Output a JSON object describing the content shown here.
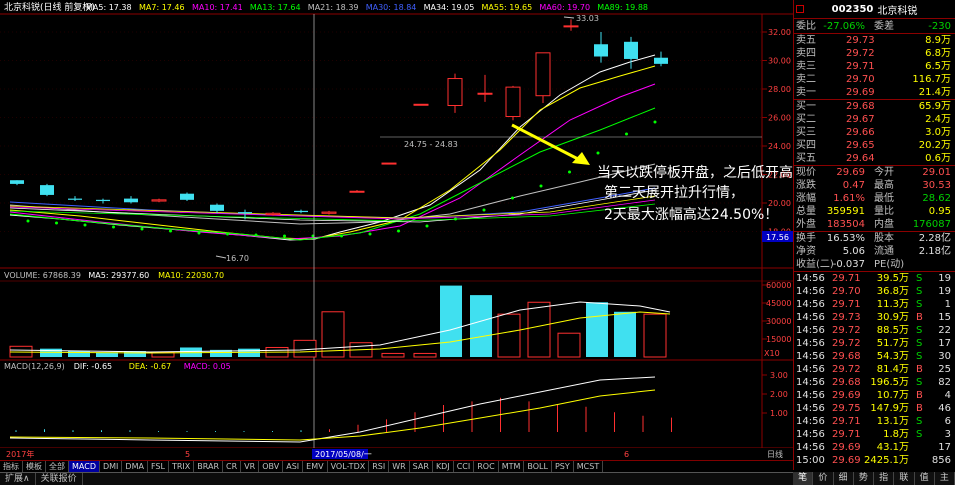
{
  "header": {
    "title": "北京科锐(日线 前复权)",
    "mas": [
      {
        "label": "MA5: 17.38",
        "color": "#ffffff"
      },
      {
        "label": "MA7: 17.46",
        "color": "#ffff00"
      },
      {
        "label": "MA10: 17.41",
        "color": "#ff00ff"
      },
      {
        "label": "MA13: 17.64",
        "color": "#00ff00"
      },
      {
        "label": "MA21: 18.39",
        "color": "#c0c0c0"
      },
      {
        "label": "MA30: 18.84",
        "color": "#4060ff"
      },
      {
        "label": "MA34: 19.05",
        "color": "#ffffff"
      },
      {
        "label": "MA55: 19.65",
        "color": "#ffff00"
      },
      {
        "label": "MA60: 19.70",
        "color": "#ff00ff"
      },
      {
        "label": "MA89: 19.88",
        "color": "#00ff00"
      }
    ]
  },
  "price_chart": {
    "y_ticks": [
      "32.00",
      "30.00",
      "28.00",
      "26.00",
      "24.00",
      "22.00",
      "20.00",
      "18.00"
    ],
    "current_price": "17.56",
    "high_label": "33.03",
    "low_label": "16.70",
    "range_label": "24.75 - 24.83",
    "annotation": [
      "当天以跌停板开盘，之后低开高走，",
      "第二天展开拉升行情，",
      "2天最大涨幅高达24.50%！"
    ]
  },
  "volume_chart": {
    "header": [
      {
        "label": "VOLUME: 67868.39",
        "color": "#c0c0c0"
      },
      {
        "label": "MA5: 29377.60",
        "color": "#ffffff"
      },
      {
        "label": "MA10: 22030.70",
        "color": "#ffff00"
      }
    ],
    "y_ticks": [
      "60000",
      "45000",
      "30000",
      "15000"
    ],
    "unit": "X10"
  },
  "macd_chart": {
    "header": [
      {
        "label": "MACD(12,26,9)",
        "color": "#c0c0c0"
      },
      {
        "label": "DIF: -0.65",
        "color": "#ffffff"
      },
      {
        "label": "DEA: -0.67",
        "color": "#ffff00"
      },
      {
        "label": "MACD: 0.05",
        "color": "#ff00ff"
      }
    ],
    "y_ticks": [
      "3.00",
      "2.00",
      "1.00"
    ]
  },
  "date_axis": {
    "year": "2017年",
    "m5": "5",
    "cursor": "2017/05/08/一",
    "m6": "6",
    "period": "日线"
  },
  "indicator_tabs": [
    "指标",
    "模板",
    "全部",
    "MACD",
    "DMI",
    "DMA",
    "FSL",
    "TRIX",
    "BRAR",
    "CR",
    "VR",
    "OBV",
    "ASI",
    "EMV",
    "VOL-TDX",
    "RSI",
    "WR",
    "SAR",
    "KDJ",
    "CCI",
    "ROC",
    "MTM",
    "BOLL",
    "PSY",
    "MCST"
  ],
  "bottom_bar": [
    "扩展∧",
    "关联报价"
  ],
  "right_tabs": [
    "笔",
    "价",
    "细",
    "势",
    "指",
    "联",
    "值",
    "主"
  ],
  "quote": {
    "code": "002350",
    "name": "北京科锐",
    "weibi": {
      "label": "委比",
      "value": "-27.06%",
      "label2": "委差",
      "value2": "-230"
    },
    "asks": [
      {
        "label": "卖五",
        "price": "29.73",
        "vol": "8.9万"
      },
      {
        "label": "卖四",
        "price": "29.72",
        "vol": "6.8万"
      },
      {
        "label": "卖三",
        "price": "29.71",
        "vol": "6.5万"
      },
      {
        "label": "卖二",
        "price": "29.70",
        "vol": "116.7万"
      },
      {
        "label": "卖一",
        "price": "29.69",
        "vol": "21.4万"
      }
    ],
    "bids": [
      {
        "label": "买一",
        "price": "29.68",
        "vol": "65.9万"
      },
      {
        "label": "买二",
        "price": "29.67",
        "vol": "2.4万"
      },
      {
        "label": "买三",
        "price": "29.66",
        "vol": "3.0万"
      },
      {
        "label": "买四",
        "price": "29.65",
        "vol": "20.2万"
      },
      {
        "label": "买五",
        "price": "29.64",
        "vol": "0.6万"
      }
    ],
    "stats": [
      {
        "l1": "现价",
        "v1": "29.69",
        "c1": "red",
        "l2": "今开",
        "v2": "29.01",
        "c2": "red"
      },
      {
        "l1": "涨跌",
        "v1": "0.47",
        "c1": "red",
        "l2": "最高",
        "v2": "30.53",
        "c2": "red"
      },
      {
        "l1": "涨幅",
        "v1": "1.61%",
        "c1": "red",
        "l2": "最低",
        "v2": "28.62",
        "c2": "grn"
      },
      {
        "l1": "总量",
        "v1": "359591",
        "c1": "yel",
        "l2": "量比",
        "v2": "0.95",
        "c2": "yel"
      },
      {
        "l1": "外盘",
        "v1": "183504",
        "c1": "red",
        "l2": "内盘",
        "v2": "176087",
        "c2": "grn"
      }
    ],
    "stats2": [
      {
        "l1": "换手",
        "v1": "16.53%",
        "l2": "股本",
        "v2": "2.28亿"
      },
      {
        "l1": "净资",
        "v1": "5.06",
        "l2": "流通",
        "v2": "2.18亿"
      },
      {
        "l1": "收益(二)",
        "v1": "-0.037",
        "l2": "PE(动)",
        "v2": ""
      }
    ],
    "ticks": [
      {
        "time": "14:56",
        "price": "29.71",
        "pc": "red",
        "vol": "39.5万",
        "flag": "S",
        "fc": "grn",
        "n": "19"
      },
      {
        "time": "14:56",
        "price": "29.70",
        "pc": "red",
        "vol": "36.8万",
        "flag": "S",
        "fc": "grn",
        "n": "19"
      },
      {
        "time": "14:56",
        "price": "29.71",
        "pc": "red",
        "vol": "11.3万",
        "flag": "S",
        "fc": "grn",
        "n": "1"
      },
      {
        "time": "14:56",
        "price": "29.73",
        "pc": "red",
        "vol": "30.9万",
        "flag": "B",
        "fc": "red",
        "n": "15"
      },
      {
        "time": "14:56",
        "price": "29.72",
        "pc": "red",
        "vol": "88.5万",
        "flag": "S",
        "fc": "grn",
        "n": "22"
      },
      {
        "time": "14:56",
        "price": "29.72",
        "pc": "red",
        "vol": "51.7万",
        "flag": "S",
        "fc": "grn",
        "n": "17"
      },
      {
        "time": "14:56",
        "price": "29.68",
        "pc": "red",
        "vol": "54.3万",
        "flag": "S",
        "fc": "grn",
        "n": "30"
      },
      {
        "time": "14:56",
        "price": "29.72",
        "pc": "red",
        "vol": "81.4万",
        "flag": "B",
        "fc": "red",
        "n": "25"
      },
      {
        "time": "14:56",
        "price": "29.68",
        "pc": "red",
        "vol": "196.5万",
        "flag": "S",
        "fc": "grn",
        "n": "82"
      },
      {
        "time": "14:56",
        "price": "29.69",
        "pc": "red",
        "vol": "10.7万",
        "flag": "B",
        "fc": "red",
        "n": "4"
      },
      {
        "time": "14:56",
        "price": "29.75",
        "pc": "red",
        "vol": "147.9万",
        "flag": "B",
        "fc": "red",
        "n": "46"
      },
      {
        "time": "14:56",
        "price": "29.71",
        "pc": "red",
        "vol": "13.1万",
        "flag": "S",
        "fc": "grn",
        "n": "6"
      },
      {
        "time": "14:56",
        "price": "29.71",
        "pc": "red",
        "vol": "1.8万",
        "flag": "S",
        "fc": "grn",
        "n": "3"
      },
      {
        "time": "14:56",
        "price": "29.69",
        "pc": "red",
        "vol": "43.1万",
        "flag": "",
        "fc": "grn",
        "n": "17"
      },
      {
        "time": "15:00",
        "price": "29.69",
        "pc": "red",
        "vol": "2425.1万",
        "flag": "",
        "fc": "grn",
        "n": "856"
      }
    ]
  }
}
